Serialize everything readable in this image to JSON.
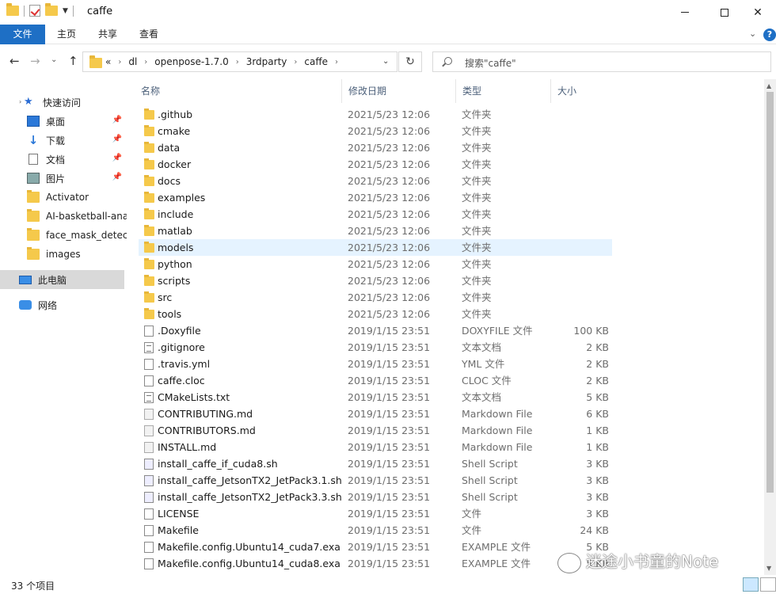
{
  "window": {
    "title": "caffe"
  },
  "ribbon": {
    "tabs": [
      {
        "label": "文件"
      },
      {
        "label": "主页"
      },
      {
        "label": "共享"
      },
      {
        "label": "查看"
      }
    ]
  },
  "address": {
    "crumbs": [
      "«",
      "dl",
      "openpose-1.7.0",
      "3rdparty",
      "caffe"
    ]
  },
  "search": {
    "placeholder": "搜索\"caffe\""
  },
  "sidebar": {
    "items": [
      {
        "label": "快速访问",
        "icon": "star-icon"
      },
      {
        "label": "桌面",
        "icon": "desktop-icon",
        "pinned": true
      },
      {
        "label": "下载",
        "icon": "download-icon",
        "pinned": true
      },
      {
        "label": "文档",
        "icon": "document-icon",
        "pinned": true
      },
      {
        "label": "图片",
        "icon": "picture-icon",
        "pinned": true
      },
      {
        "label": "Activator",
        "icon": "folder-icon"
      },
      {
        "label": "AI-basketball-ana",
        "icon": "folder-icon"
      },
      {
        "label": "face_mask_detecti",
        "icon": "folder-icon"
      },
      {
        "label": "images",
        "icon": "folder-icon"
      },
      {
        "label": "此电脑",
        "icon": "computer-icon",
        "selected": true
      },
      {
        "label": "网络",
        "icon": "network-icon"
      }
    ]
  },
  "columns": {
    "name": "名称",
    "date": "修改日期",
    "type": "类型",
    "size": "大小"
  },
  "files": [
    {
      "name": ".github",
      "date": "2021/5/23 12:06",
      "type": "文件夹",
      "size": "",
      "icon": "folder"
    },
    {
      "name": "cmake",
      "date": "2021/5/23 12:06",
      "type": "文件夹",
      "size": "",
      "icon": "folder"
    },
    {
      "name": "data",
      "date": "2021/5/23 12:06",
      "type": "文件夹",
      "size": "",
      "icon": "folder"
    },
    {
      "name": "docker",
      "date": "2021/5/23 12:06",
      "type": "文件夹",
      "size": "",
      "icon": "folder"
    },
    {
      "name": "docs",
      "date": "2021/5/23 12:06",
      "type": "文件夹",
      "size": "",
      "icon": "folder"
    },
    {
      "name": "examples",
      "date": "2021/5/23 12:06",
      "type": "文件夹",
      "size": "",
      "icon": "folder"
    },
    {
      "name": "include",
      "date": "2021/5/23 12:06",
      "type": "文件夹",
      "size": "",
      "icon": "folder"
    },
    {
      "name": "matlab",
      "date": "2021/5/23 12:06",
      "type": "文件夹",
      "size": "",
      "icon": "folder"
    },
    {
      "name": "models",
      "date": "2021/5/23 12:06",
      "type": "文件夹",
      "size": "",
      "icon": "folder",
      "highlight": true
    },
    {
      "name": "python",
      "date": "2021/5/23 12:06",
      "type": "文件夹",
      "size": "",
      "icon": "folder"
    },
    {
      "name": "scripts",
      "date": "2021/5/23 12:06",
      "type": "文件夹",
      "size": "",
      "icon": "folder"
    },
    {
      "name": "src",
      "date": "2021/5/23 12:06",
      "type": "文件夹",
      "size": "",
      "icon": "folder"
    },
    {
      "name": "tools",
      "date": "2021/5/23 12:06",
      "type": "文件夹",
      "size": "",
      "icon": "folder"
    },
    {
      "name": ".Doxyfile",
      "date": "2019/1/15 23:51",
      "type": "DOXYFILE 文件",
      "size": "100 KB",
      "icon": "file"
    },
    {
      "name": ".gitignore",
      "date": "2019/1/15 23:51",
      "type": "文本文档",
      "size": "2 KB",
      "icon": "text"
    },
    {
      "name": ".travis.yml",
      "date": "2019/1/15 23:51",
      "type": "YML 文件",
      "size": "2 KB",
      "icon": "file"
    },
    {
      "name": "caffe.cloc",
      "date": "2019/1/15 23:51",
      "type": "CLOC 文件",
      "size": "2 KB",
      "icon": "file"
    },
    {
      "name": "CMakeLists.txt",
      "date": "2019/1/15 23:51",
      "type": "文本文档",
      "size": "5 KB",
      "icon": "text"
    },
    {
      "name": "CONTRIBUTING.md",
      "date": "2019/1/15 23:51",
      "type": "Markdown File",
      "size": "6 KB",
      "icon": "md"
    },
    {
      "name": "CONTRIBUTORS.md",
      "date": "2019/1/15 23:51",
      "type": "Markdown File",
      "size": "1 KB",
      "icon": "md"
    },
    {
      "name": "INSTALL.md",
      "date": "2019/1/15 23:51",
      "type": "Markdown File",
      "size": "1 KB",
      "icon": "md"
    },
    {
      "name": "install_caffe_if_cuda8.sh",
      "date": "2019/1/15 23:51",
      "type": "Shell Script",
      "size": "3 KB",
      "icon": "sh"
    },
    {
      "name": "install_caffe_JetsonTX2_JetPack3.1.sh",
      "date": "2019/1/15 23:51",
      "type": "Shell Script",
      "size": "3 KB",
      "icon": "sh"
    },
    {
      "name": "install_caffe_JetsonTX2_JetPack3.3.sh",
      "date": "2019/1/15 23:51",
      "type": "Shell Script",
      "size": "3 KB",
      "icon": "sh"
    },
    {
      "name": "LICENSE",
      "date": "2019/1/15 23:51",
      "type": "文件",
      "size": "3 KB",
      "icon": "file"
    },
    {
      "name": "Makefile",
      "date": "2019/1/15 23:51",
      "type": "文件",
      "size": "24 KB",
      "icon": "file"
    },
    {
      "name": "Makefile.config.Ubuntu14_cuda7.exa...",
      "date": "2019/1/15 23:51",
      "type": "EXAMPLE 文件",
      "size": "5 KB",
      "icon": "file"
    },
    {
      "name": "Makefile.config.Ubuntu14_cuda8.exa...",
      "date": "2019/1/15 23:51",
      "type": "EXAMPLE 文件",
      "size": "5 KB",
      "icon": "file"
    }
  ],
  "status": {
    "count": "33 个项目"
  },
  "watermark": {
    "text": "迷途小书童的Note"
  }
}
